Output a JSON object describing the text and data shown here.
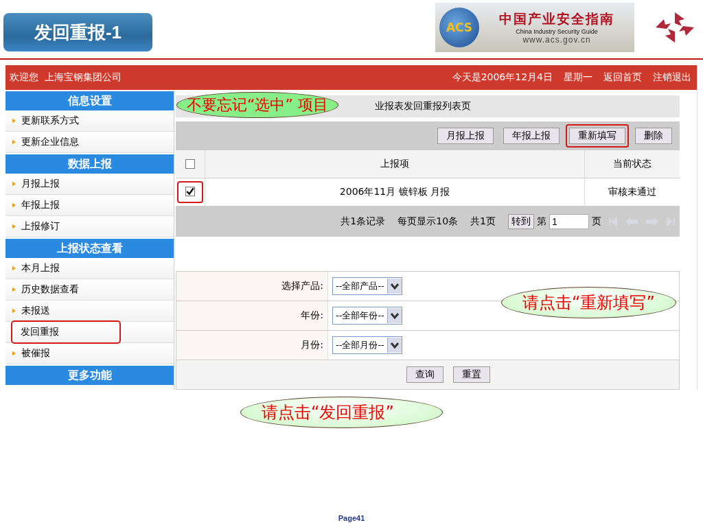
{
  "slide": {
    "title": "发回重报-1",
    "page": "Page41"
  },
  "logo_banner": {
    "badge": "ACS",
    "title": "中国产业安全指南",
    "subtitle": "China Industry Security Guide",
    "url": "www.acs.gov.cn"
  },
  "top_bar": {
    "welcome": "欢迎您  上海宝钢集团公司",
    "date": "今天是2006年12月4日",
    "weekday": "星期一",
    "links": [
      "返回首页",
      "注销退出"
    ]
  },
  "sidebar": {
    "sections": [
      {
        "title": "信息设置",
        "items": [
          {
            "label": "更新联系方式",
            "highlighted": false
          },
          {
            "label": "更新企业信息",
            "highlighted": false
          }
        ]
      },
      {
        "title": "数据上报",
        "items": [
          {
            "label": "月报上报",
            "highlighted": false
          },
          {
            "label": "年报上报",
            "highlighted": false
          },
          {
            "label": "上报修订",
            "highlighted": false
          }
        ]
      },
      {
        "title": "上报状态查看",
        "items": [
          {
            "label": "本月上报",
            "highlighted": false
          },
          {
            "label": "历史数据查看",
            "highlighted": false
          },
          {
            "label": "未报送",
            "highlighted": false
          },
          {
            "label": "发回重报",
            "highlighted": true
          },
          {
            "label": "被催报",
            "highlighted": false
          }
        ]
      },
      {
        "title": "更多功能"
      }
    ]
  },
  "breadcrumb": "业报表发回重报列表页",
  "toolbar": {
    "buttons": [
      {
        "label": "月报上报",
        "highlighted": false
      },
      {
        "label": "年报上报",
        "highlighted": false
      },
      {
        "label": "重新填写",
        "highlighted": true
      },
      {
        "label": "删除",
        "highlighted": false
      }
    ]
  },
  "table": {
    "columns": [
      "上报项",
      "当前状态"
    ],
    "header_checkbox": {
      "checked": false
    },
    "rows": [
      {
        "checked": true,
        "highlighted": true,
        "item": "2006年11月  镀锌板  月报",
        "status": "审核未通过"
      }
    ]
  },
  "pager": {
    "summary": [
      "共1条记录",
      "每页显示10条",
      "共1页"
    ],
    "goto_button": "转到",
    "page_prefix": "第",
    "page_value": "1",
    "page_suffix": "页"
  },
  "filters": [
    {
      "label": "选择产品:",
      "value": "--全部产品--"
    },
    {
      "label": "年份:",
      "value": "--全部年份--"
    },
    {
      "label": "月份:",
      "value": "--全部月份--"
    }
  ],
  "form_buttons": [
    "查询",
    "重置"
  ],
  "callouts": [
    {
      "text": "不要忘记“选中” 项目"
    },
    {
      "text": "请点击“重新填写”"
    },
    {
      "text": "请点击“发回重报”"
    }
  ]
}
